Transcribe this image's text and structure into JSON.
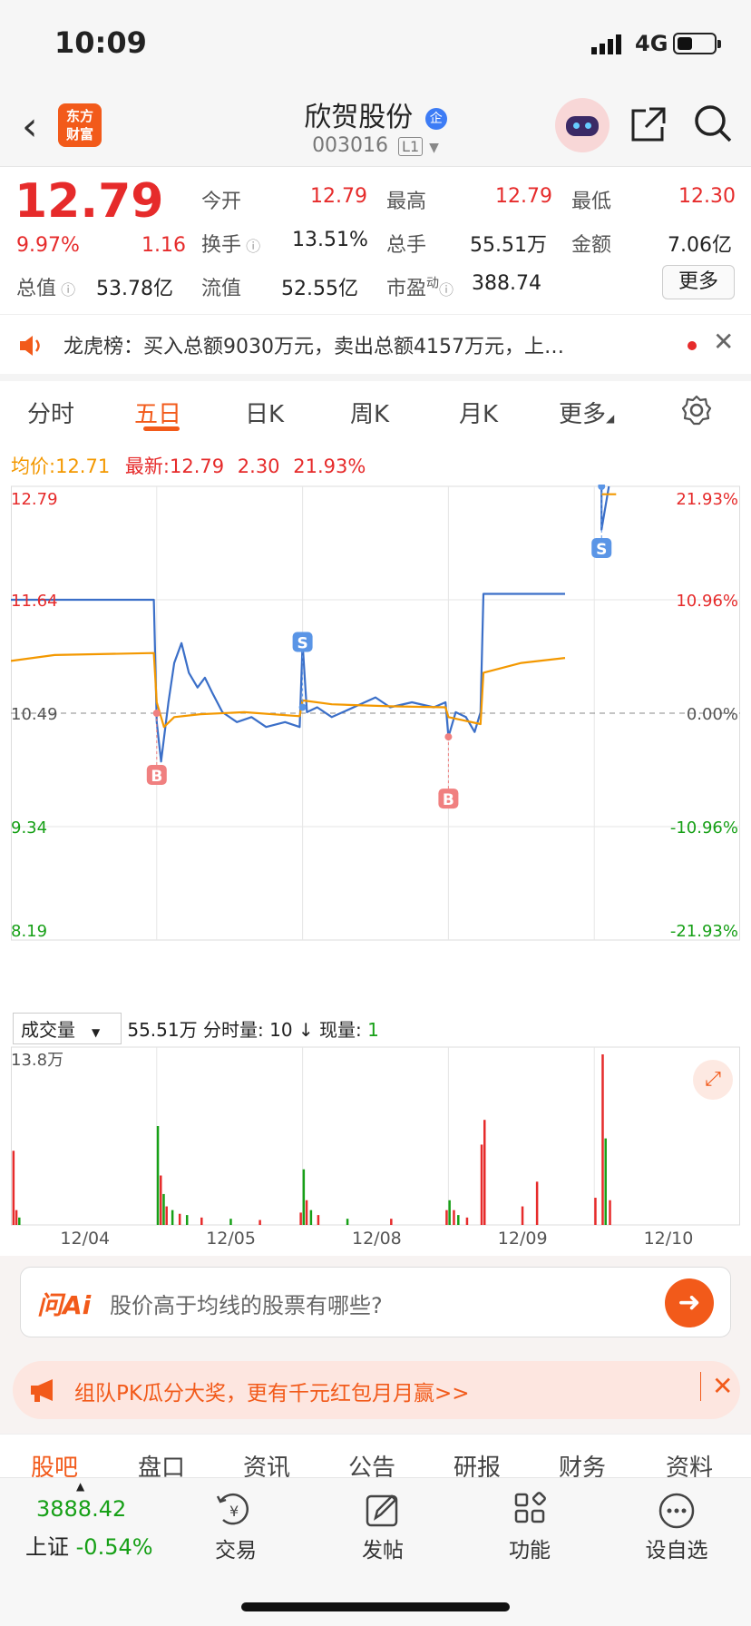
{
  "status_bar": {
    "time": "10:09",
    "network": "4G"
  },
  "header": {
    "back_icon": "chevron-left-icon",
    "app_logo": "东方财富",
    "stock_name": "欣贺股份",
    "stock_badge": "企",
    "stock_code": "003016",
    "level": "L1"
  },
  "quote": {
    "price": "12.79",
    "change_pct": "9.97%",
    "change": "1.16",
    "fields": {
      "open_label": "今开",
      "open": "12.79",
      "high_label": "最高",
      "high": "12.79",
      "low_label": "最低",
      "low": "12.30",
      "turnover_label": "换手",
      "turnover": "13.51%",
      "volume_label": "总手",
      "volume": "55.51万",
      "amount_label": "金额",
      "amount": "7.06亿",
      "mcap_label": "总值",
      "mcap": "53.78亿",
      "float_label": "流值",
      "float_value": "52.55亿",
      "pe_label": "市盈",
      "pe_sup": "动",
      "pe": "388.74"
    },
    "more_button": "更多"
  },
  "notice": {
    "text": "龙虎榜：买入总额9030万元，卖出总额4157万元，上…"
  },
  "tabs": [
    "分时",
    "五日",
    "日K",
    "周K",
    "月K",
    "更多"
  ],
  "active_tab": "五日",
  "legend": {
    "avg_label": "均价:",
    "avg": "12.71",
    "latest_label": "最新:",
    "latest": "12.79",
    "chg": "2.30",
    "chg_pct": "21.93%"
  },
  "chart_data": {
    "type": "line",
    "title": "",
    "x": [
      "12/04",
      "12/05",
      "12/08",
      "12/09",
      "12/10"
    ],
    "y_ticks_left": [
      "12.79",
      "11.64",
      "10.49",
      "9.34",
      "8.19"
    ],
    "y_ticks_right": [
      "21.93%",
      "10.96%",
      "0.00%",
      "-10.96%",
      "-21.93%"
    ],
    "ylim": [
      8.19,
      12.79
    ],
    "base_price": 10.49,
    "grid": true,
    "series": [
      {
        "name": "",
        "color": "#3b6fc8",
        "points": [
          [
            0.0,
            11.64
          ],
          [
            0.98,
            11.64
          ],
          [
            1.0,
            10.4
          ],
          [
            1.03,
            10.0
          ],
          [
            1.08,
            10.6
          ],
          [
            1.12,
            11.0
          ],
          [
            1.17,
            11.2
          ],
          [
            1.22,
            10.9
          ],
          [
            1.28,
            10.75
          ],
          [
            1.33,
            10.85
          ],
          [
            1.38,
            10.7
          ],
          [
            1.45,
            10.5
          ],
          [
            1.55,
            10.4
          ],
          [
            1.65,
            10.45
          ],
          [
            1.75,
            10.35
          ],
          [
            1.88,
            10.4
          ],
          [
            1.98,
            10.35
          ],
          [
            2.0,
            11.2
          ],
          [
            2.03,
            10.5
          ],
          [
            2.1,
            10.55
          ],
          [
            2.2,
            10.45
          ],
          [
            2.35,
            10.55
          ],
          [
            2.5,
            10.65
          ],
          [
            2.6,
            10.55
          ],
          [
            2.75,
            10.6
          ],
          [
            2.9,
            10.55
          ],
          [
            2.98,
            10.6
          ],
          [
            3.0,
            10.25
          ],
          [
            3.05,
            10.5
          ],
          [
            3.12,
            10.45
          ],
          [
            3.18,
            10.3
          ],
          [
            3.22,
            10.5
          ],
          [
            3.24,
            11.7
          ],
          [
            3.8,
            11.7
          ]
        ]
      },
      {
        "name": "",
        "color": "#f39800",
        "points": [
          [
            0.0,
            11.02
          ],
          [
            0.3,
            11.08
          ],
          [
            0.98,
            11.1
          ],
          [
            1.0,
            10.6
          ],
          [
            1.05,
            10.35
          ],
          [
            1.12,
            10.45
          ],
          [
            1.3,
            10.48
          ],
          [
            1.6,
            10.5
          ],
          [
            1.98,
            10.46
          ],
          [
            2.0,
            10.62
          ],
          [
            2.2,
            10.58
          ],
          [
            2.6,
            10.56
          ],
          [
            2.98,
            10.55
          ],
          [
            3.0,
            10.45
          ],
          [
            3.22,
            10.38
          ],
          [
            3.24,
            10.9
          ],
          [
            3.5,
            11.0
          ],
          [
            3.8,
            11.05
          ]
        ]
      },
      {
        "name": "",
        "color": "#3b6fc8",
        "points": [
          [
            4.05,
            12.79
          ],
          [
            4.05,
            12.35
          ],
          [
            4.1,
            12.79
          ]
        ]
      },
      {
        "name": "",
        "color": "#f39800",
        "points": [
          [
            4.05,
            12.71
          ],
          [
            4.15,
            12.71
          ]
        ]
      }
    ],
    "markers": [
      {
        "label": "B",
        "x": 1.0,
        "y": 10.49,
        "dir": "down"
      },
      {
        "label": "S",
        "x": 2.0,
        "y": 10.55,
        "dir": "up"
      },
      {
        "label": "B",
        "x": 3.0,
        "y": 10.25,
        "dir": "down"
      },
      {
        "label": "S",
        "x": 4.05,
        "y": 12.79,
        "dir": "down"
      }
    ],
    "volume": {
      "label": "成交量",
      "total": "55.51万",
      "min_label": "分时量:",
      "min_value": "10 ↓",
      "now_label": "现量:",
      "now_value": "1",
      "max_label": "13.8万",
      "max": 13.8,
      "bars": [
        [
          0.01,
          6.0,
          "r"
        ],
        [
          0.03,
          1.2,
          "r"
        ],
        [
          0.05,
          0.6,
          "g"
        ],
        [
          1.0,
          8.0,
          "g"
        ],
        [
          1.02,
          4.0,
          "r"
        ],
        [
          1.04,
          2.5,
          "g"
        ],
        [
          1.06,
          1.5,
          "r"
        ],
        [
          1.1,
          1.2,
          "g"
        ],
        [
          1.15,
          0.9,
          "r"
        ],
        [
          1.2,
          0.8,
          "g"
        ],
        [
          1.3,
          0.6,
          "r"
        ],
        [
          1.5,
          0.5,
          "g"
        ],
        [
          1.7,
          0.4,
          "r"
        ],
        [
          1.98,
          1.0,
          "r"
        ],
        [
          2.0,
          4.5,
          "g"
        ],
        [
          2.02,
          2.0,
          "r"
        ],
        [
          2.05,
          1.2,
          "g"
        ],
        [
          2.1,
          0.8,
          "r"
        ],
        [
          2.3,
          0.5,
          "g"
        ],
        [
          2.6,
          0.5,
          "r"
        ],
        [
          2.98,
          1.2,
          "r"
        ],
        [
          3.0,
          2.0,
          "g"
        ],
        [
          3.03,
          1.2,
          "r"
        ],
        [
          3.06,
          0.8,
          "g"
        ],
        [
          3.12,
          0.6,
          "r"
        ],
        [
          3.22,
          6.5,
          "r"
        ],
        [
          3.24,
          8.5,
          "r"
        ],
        [
          3.5,
          1.5,
          "r"
        ],
        [
          3.6,
          3.5,
          "r"
        ],
        [
          4.0,
          2.2,
          "r"
        ],
        [
          4.05,
          13.8,
          "r"
        ],
        [
          4.07,
          7.0,
          "g"
        ],
        [
          4.1,
          2.0,
          "r"
        ]
      ]
    }
  },
  "ask_ai": {
    "logo": "问Ai",
    "placeholder": "股价高于均线的股票有哪些?"
  },
  "promo": {
    "text": "组队PK瓜分大奖，更有千元红包月月赢>>"
  },
  "sub_tabs": [
    "股吧",
    "盘口",
    "资讯",
    "公告",
    "研报",
    "财务",
    "资料"
  ],
  "bottom_nav": {
    "index_value": "3888.42",
    "index_name": "上证",
    "index_change": "-0.54%",
    "items": [
      "交易",
      "发帖",
      "功能",
      "设自选"
    ]
  }
}
